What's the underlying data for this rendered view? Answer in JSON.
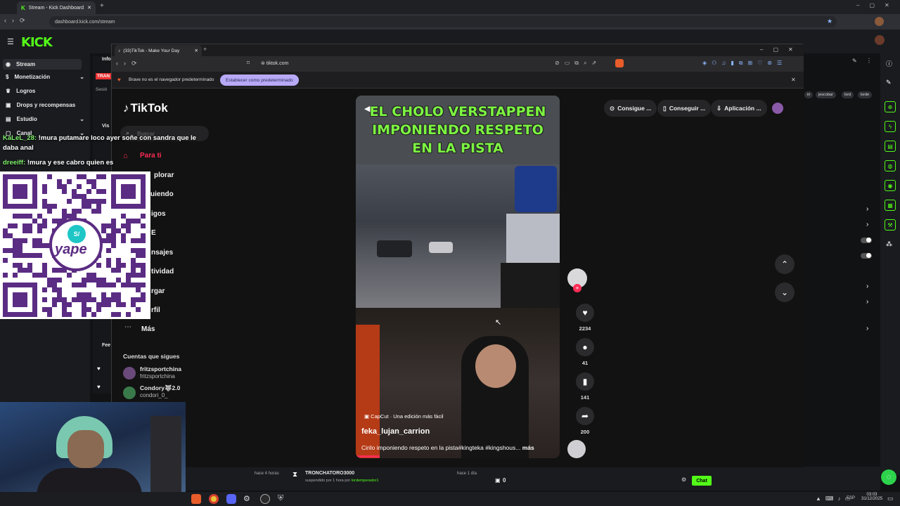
{
  "outer_browser": {
    "tab_title": "Stream - Kick Dashboard",
    "url": "dashboard.kick.com/stream"
  },
  "kick": {
    "logo": "KICK",
    "sidebar": [
      {
        "label": "Stream",
        "has_chevron": false
      },
      {
        "label": "Monetización",
        "has_chevron": true
      },
      {
        "label": "Logros",
        "has_chevron": false
      },
      {
        "label": "Drops y recompensas",
        "has_chevron": false
      },
      {
        "label": "Estudio",
        "has_chevron": true
      },
      {
        "label": "Canal",
        "has_chevron": true
      }
    ],
    "partial_labels": {
      "info": "Info",
      "tran": "TRAN",
      "sesion": "Sesió",
      "vis": "Vis",
      "fee": "Fee"
    },
    "tags": [
      "iri",
      "jescobar",
      "lord",
      "lorde"
    ],
    "bottom": {
      "time_left": "hace 4 horas",
      "user": "TRONCHATORO3000",
      "status": "suspendido por 1 hora por",
      "by": "lordemperador1",
      "time_right": "hace 1 día",
      "count": "0",
      "chat_button": "Chat"
    }
  },
  "tiktok_window": {
    "tab_title": "(33)TikTok - Make Your Day",
    "url": "tiktok.com",
    "infobar_text": "Brave no es el navegador predeterminado",
    "infobar_button": "Establecer como predeterminado",
    "logo": "TikTok",
    "search_placeholder": "Buscar",
    "nav": [
      "Para ti",
      "plorar",
      "uiendo",
      "igos",
      "E",
      "nsajes",
      "tividad",
      "rgar",
      "rfil",
      "Más"
    ],
    "following_header": "Cuentas que sigues",
    "following": [
      {
        "name": "fritzsportchina",
        "handle": "fritzsportchina"
      },
      {
        "name": "Condory🐺2.0",
        "handle": "condori_0_"
      }
    ],
    "top_pills": [
      "Consigue ...",
      "Conseguir ...",
      "Aplicación ..."
    ],
    "video": {
      "title_line1": "EL CHOLO VERSTAPPEN",
      "title_line2": "IMPONIENDO RESPETO",
      "title_line3": "EN LA PISTA",
      "capcut": "CapCut · Una edición más fácil",
      "author": "feka_lujan_carrion",
      "caption": "Cirilo imponiendo respeto en la pista#kingteka #kingshous...",
      "more": "más"
    },
    "actions": {
      "likes": "2234",
      "comments": "41",
      "saves": "141",
      "shares": "200"
    }
  },
  "overlay": {
    "chat": [
      {
        "user": "KaLeL_28:",
        "text": " !mura putamare loco ayer soñe con sandra que le",
        "text2": "daba anal"
      },
      {
        "user": "dreeiff:",
        "text": " !mura y ese cabro quien es"
      }
    ],
    "qr_label": "yape",
    "qr_badge": "S/"
  },
  "taskbar": {
    "lang": "ESP",
    "time": "03:03",
    "date": "31/12/2025"
  }
}
